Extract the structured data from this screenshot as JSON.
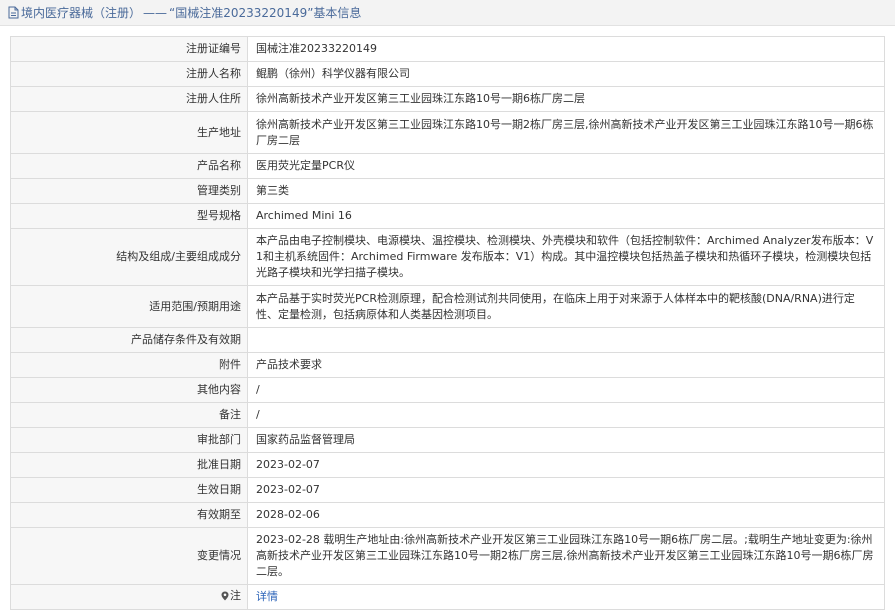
{
  "header": {
    "breadcrumb": "境内医疗器械（注册）",
    "separator": "——",
    "record_title": "“国械注准20233220149”基本信息"
  },
  "rows": [
    {
      "label": "注册证编号",
      "value": "国械注准20233220149"
    },
    {
      "label": "注册人名称",
      "value": "鲲鹏（徐州）科学仪器有限公司"
    },
    {
      "label": "注册人住所",
      "value": "徐州高新技术产业开发区第三工业园珠江东路10号一期6栋厂房二层"
    },
    {
      "label": "生产地址",
      "value": "徐州高新技术产业开发区第三工业园珠江东路10号一期2栋厂房三层,徐州高新技术产业开发区第三工业园珠江东路10号一期6栋厂房二层"
    },
    {
      "label": "产品名称",
      "value": "医用荧光定量PCR仪"
    },
    {
      "label": "管理类别",
      "value": "第三类"
    },
    {
      "label": "型号规格",
      "value": "Archimed Mini 16"
    },
    {
      "label": "结构及组成/主要组成成分",
      "value": "本产品由电子控制模块、电源模块、温控模块、检测模块、外壳模块和软件（包括控制软件：Archimed Analyzer发布版本：V1和主机系统固件：Archimed Firmware 发布版本：V1）构成。其中温控模块包括热盖子模块和热循环子模块，检测模块包括光路子模块和光学扫描子模块。"
    },
    {
      "label": "适用范围/预期用途",
      "value": "本产品基于实时荧光PCR检测原理，配合检测试剂共同使用，在临床上用于对来源于人体样本中的靶核酸(DNA/RNA)进行定性、定量检测，包括病原体和人类基因检测项目。"
    },
    {
      "label": "产品储存条件及有效期",
      "value": ""
    },
    {
      "label": "附件",
      "value": "产品技术要求"
    },
    {
      "label": "其他内容",
      "value": "/"
    },
    {
      "label": "备注",
      "value": "/"
    },
    {
      "label": "审批部门",
      "value": "国家药品监督管理局"
    },
    {
      "label": "批准日期",
      "value": "2023-02-07"
    },
    {
      "label": "生效日期",
      "value": "2023-02-07"
    },
    {
      "label": "有效期至",
      "value": "2028-02-06"
    },
    {
      "label": "变更情况",
      "value": "2023-02-28 载明生产地址由:徐州高新技术产业开发区第三工业园珠江东路10号一期6栋厂房二层。;载明生产地址变更为:徐州高新技术产业开发区第三工业园珠江东路10号一期2栋厂房三层,徐州高新技术产业开发区第三工业园珠江东路10号一期6栋厂房二层。"
    }
  ],
  "note_row": {
    "label": "注",
    "link_text": "详情"
  },
  "colors": {
    "link": "#2a62b8",
    "title": "#4a6a9a",
    "label_bg": "#f7f7f7",
    "border": "#dcdcdc"
  }
}
